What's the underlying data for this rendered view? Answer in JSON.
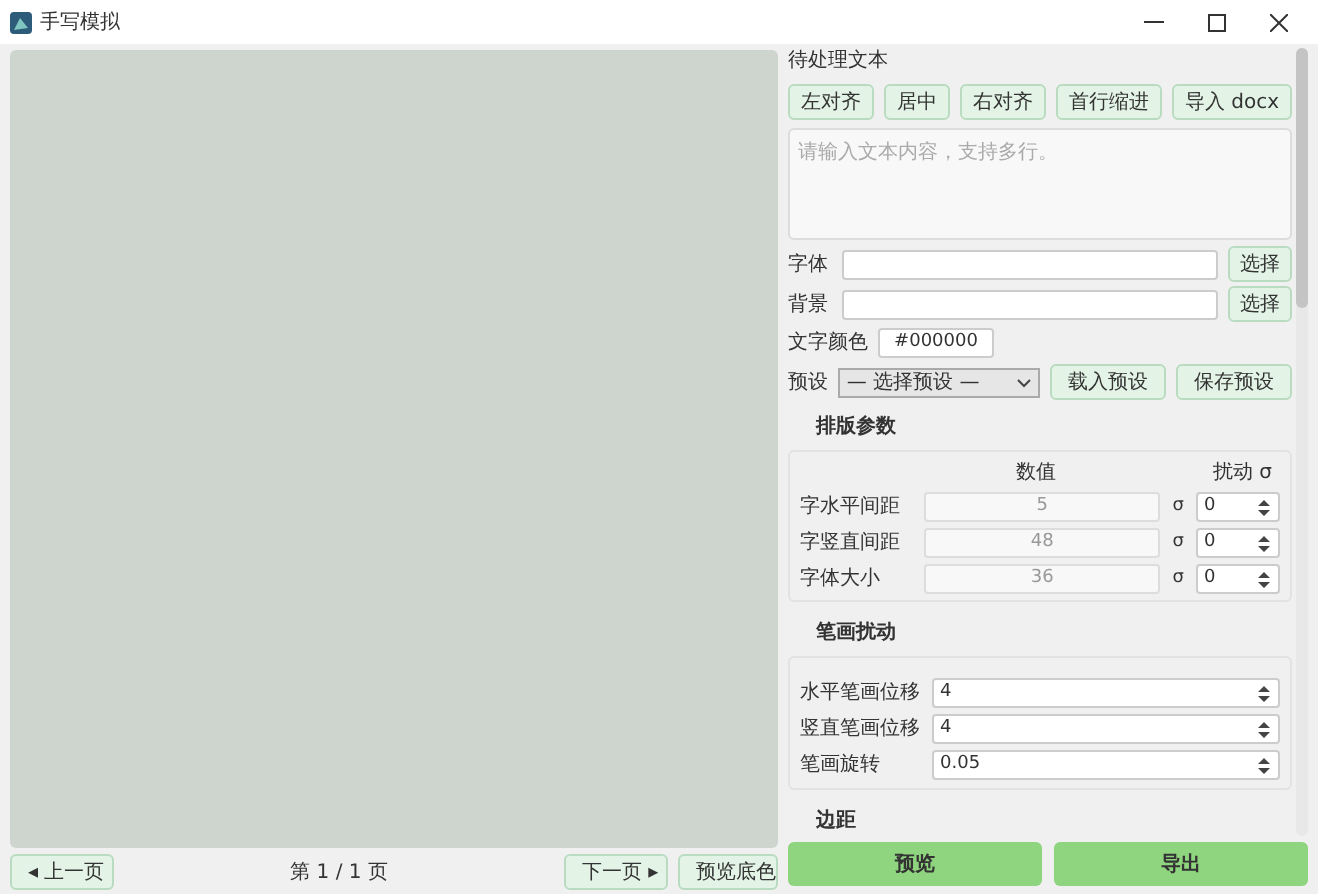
{
  "window": {
    "title": "手写模拟"
  },
  "text_section": {
    "title": "待处理文本",
    "buttons": [
      "左对齐",
      "居中",
      "右对齐",
      "首行缩进",
      "导入 docx"
    ],
    "placeholder": "请输入文本内容，支持多行。"
  },
  "file_rows": [
    {
      "label": "字体",
      "button": "选择"
    },
    {
      "label": "背景",
      "button": "选择"
    }
  ],
  "text_color": {
    "label": "文字颜色",
    "value": "#000000"
  },
  "preset": {
    "label": "预设",
    "value": "— 选择预设 —",
    "buttons": [
      "载入预设",
      "保存预设"
    ]
  },
  "layout_group": {
    "title": "排版参数",
    "value_header": "数值",
    "jitter_header": "扰动 σ",
    "rows": [
      {
        "label": "字水平间距",
        "value": "5",
        "disabled": true,
        "sigma": "σ",
        "jitter": "0"
      },
      {
        "label": "字竖直间距",
        "value": "48",
        "disabled": true,
        "sigma": "σ",
        "jitter": "0"
      },
      {
        "label": "字体大小",
        "value": "36",
        "disabled": true,
        "sigma": "σ",
        "jitter": "0"
      }
    ]
  },
  "stroke_group": {
    "title": "笔画扰动",
    "rows": [
      {
        "label": "水平笔画位移",
        "value": "4"
      },
      {
        "label": "竖直笔画位移",
        "value": "4"
      },
      {
        "label": "笔画旋转",
        "value": "0.05"
      }
    ]
  },
  "margin_group": {
    "title": "边距"
  },
  "actions": [
    "预览",
    "导出"
  ],
  "pager": {
    "prev": "◂ 上一页",
    "page": "第 1 / 1 页",
    "next": "下一页 ▸",
    "bg": "预览底色"
  }
}
